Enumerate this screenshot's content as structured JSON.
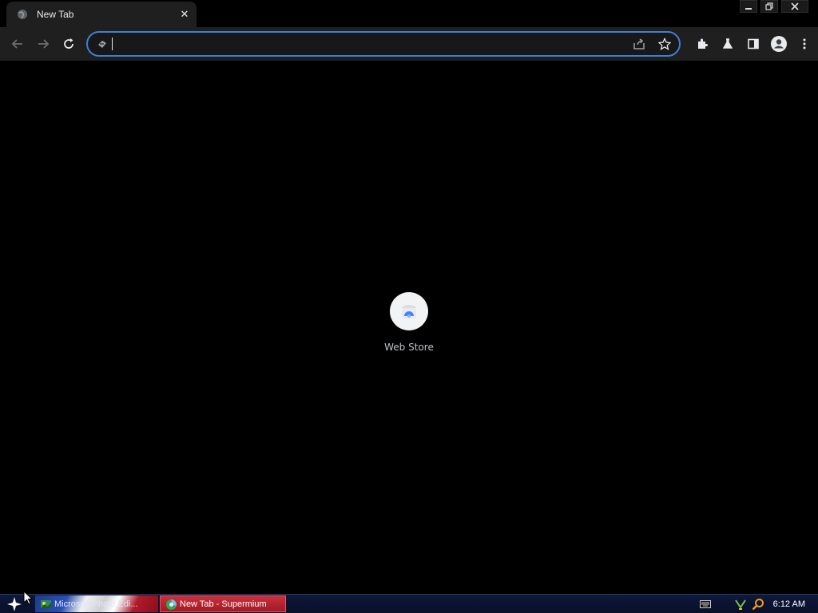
{
  "browser": {
    "tab": {
      "title": "New Tab",
      "close_glyph": "✕",
      "favicon": "globe-icon"
    },
    "window_controls": {
      "minimize": "minimize-icon",
      "restore": "restore-icon",
      "close": "close-icon"
    },
    "toolbar": {
      "back": "back-arrow-icon",
      "forward": "forward-arrow-icon",
      "reload": "reload-icon",
      "omnibox": {
        "value": "",
        "placeholder": "",
        "left_icon": "search-engine-icon"
      },
      "omnibox_actions": [
        "share-icon",
        "star-icon"
      ],
      "right_buttons": [
        "extensions-icon",
        "labs-icon",
        "side-panel-icon",
        "profile-icon",
        "menu-icon"
      ]
    },
    "new_tab_page": {
      "shortcuts": [
        {
          "label": "Web Store",
          "icon": "web-store-icon"
        }
      ]
    }
  },
  "taskbar": {
    "start": "start-star-icon",
    "items": [
      {
        "label": "Microsoft Photo Edi...",
        "icon": "photo-editor-icon"
      },
      {
        "label": "New Tab - Supermium",
        "icon": "supermium-icon"
      }
    ],
    "tray": [
      "keyboard-icon",
      "network-icon",
      "search-magnifier-icon"
    ],
    "clock": "6:12 AM"
  },
  "colors": {
    "accent": "#3e7fd6",
    "toolbar_bg": "#1f1f1f",
    "page_bg": "#000000",
    "taskbar_active": "#b3222e"
  }
}
